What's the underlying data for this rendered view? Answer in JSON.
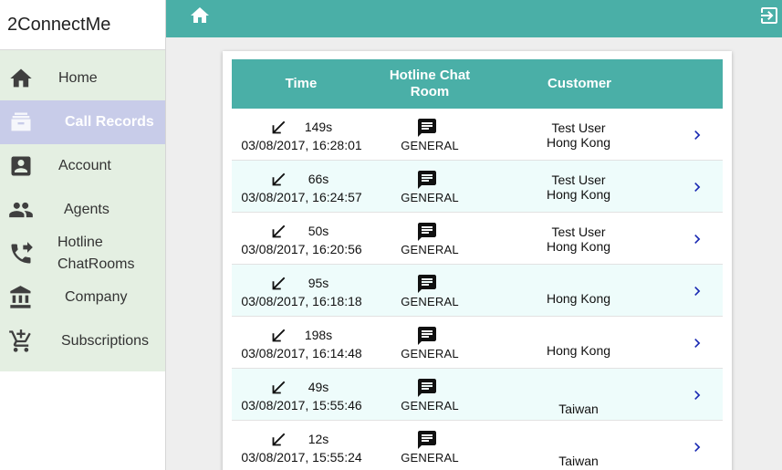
{
  "app": {
    "brand": "2ConnectMe"
  },
  "nav": [
    {
      "id": "home",
      "label": "Home",
      "icon": "home-icon",
      "active": false
    },
    {
      "id": "call-records",
      "label": "Call Records",
      "icon": "archive-box-icon",
      "active": true
    },
    {
      "id": "account",
      "label": "Account",
      "icon": "account-box-icon",
      "active": false
    },
    {
      "id": "agents",
      "label": "Agents",
      "icon": "people-icon",
      "active": false
    },
    {
      "id": "hotline",
      "label": "Hotline ChatRooms",
      "icon": "phone-forward-icon",
      "active": false
    },
    {
      "id": "company",
      "label": "Company",
      "icon": "bank-icon",
      "active": false
    },
    {
      "id": "subscriptions",
      "label": "Subscriptions",
      "icon": "add-shopping-cart-icon",
      "active": false
    }
  ],
  "topbar": {
    "home_icon": "home-icon",
    "exit_icon": "exit-to-app-icon"
  },
  "colors": {
    "accent": "#4aafa7",
    "sidebar_bg": "#e4efe2",
    "active_nav": "#c8cce9",
    "row_alt": "#eefcfb",
    "chevron": "#1b2bb3"
  },
  "table": {
    "headers": {
      "time": "Time",
      "room": "Hotline Chat Room",
      "customer": "Customer"
    },
    "rows": [
      {
        "direction_icon": "call-received-icon",
        "duration": "149s",
        "datetime": "03/08/2017, 16:28:01",
        "room": "GENERAL",
        "customer_name": "Test User",
        "customer_location": "Hong Kong"
      },
      {
        "direction_icon": "call-received-icon",
        "duration": "66s",
        "datetime": "03/08/2017, 16:24:57",
        "room": "GENERAL",
        "customer_name": "Test User",
        "customer_location": "Hong Kong"
      },
      {
        "direction_icon": "call-received-icon",
        "duration": "50s",
        "datetime": "03/08/2017, 16:20:56",
        "room": "GENERAL",
        "customer_name": "Test User",
        "customer_location": "Hong Kong"
      },
      {
        "direction_icon": "call-received-icon",
        "duration": "95s",
        "datetime": "03/08/2017, 16:18:18",
        "room": "GENERAL",
        "customer_name": "",
        "customer_location": "Hong Kong"
      },
      {
        "direction_icon": "call-received-icon",
        "duration": "198s",
        "datetime": "03/08/2017, 16:14:48",
        "room": "GENERAL",
        "customer_name": "",
        "customer_location": "Hong Kong"
      },
      {
        "direction_icon": "call-received-icon",
        "duration": "49s",
        "datetime": "03/08/2017, 15:55:46",
        "room": "GENERAL",
        "customer_name": "",
        "customer_location": "Taiwan"
      },
      {
        "direction_icon": "call-received-icon",
        "duration": "12s",
        "datetime": "03/08/2017, 15:55:24",
        "room": "GENERAL",
        "customer_name": "",
        "customer_location": "Taiwan"
      }
    ]
  }
}
